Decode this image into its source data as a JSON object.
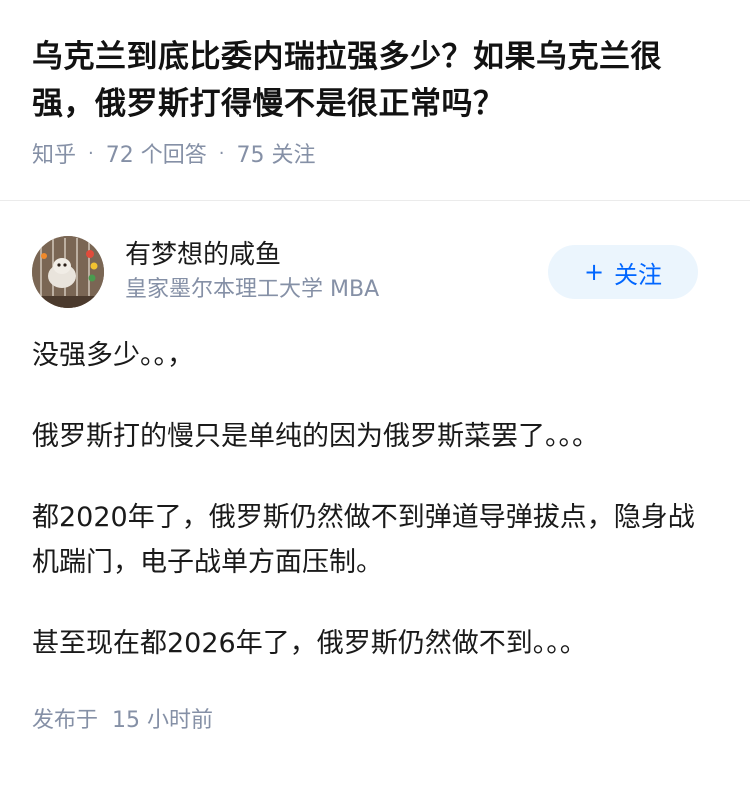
{
  "question": {
    "title": "乌克兰到底比委内瑞拉强多少？如果乌克兰很强，俄罗斯打得慢不是很正常吗？",
    "source": "知乎",
    "answer_count": "72 个回答",
    "follow_count": "75 关注"
  },
  "answer": {
    "author_name": "有梦想的咸鱼",
    "author_headline": "皇家墨尔本理工大学 MBA",
    "follow_label": "关注",
    "follow_icon": "plus-icon",
    "paragraphs": [
      "没强多少。。，",
      "俄罗斯打的慢只是单纯的因为俄罗斯菜罢了。。。",
      "都2020年了，俄罗斯仍然做不到弹道导弹拔点，隐身战机踹门，电子战单方面压制。",
      "甚至现在都2026年了，俄罗斯仍然做不到。。。"
    ],
    "time_prefix": "发布于",
    "time_value": "15 小时前"
  },
  "colors": {
    "meta": "#8590a6",
    "accent": "#0066ff",
    "follow_bg": "#ebf5fd"
  }
}
